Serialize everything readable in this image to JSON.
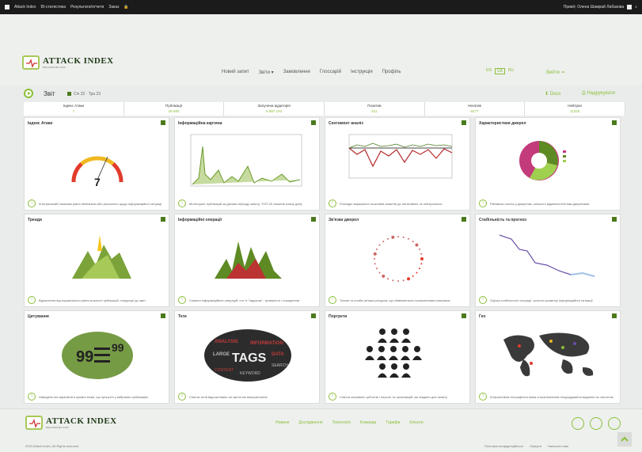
{
  "topbar": {
    "items": [
      "Attack Index",
      "BI-статистика",
      "Результати/отчети",
      "Заказ"
    ],
    "greeting": "Привіт, Олена Шамрай Лабазова"
  },
  "brand": {
    "name": "ATTACK INDEX",
    "tagline": "ВІД ІНТЕРНЕТ-АТАК"
  },
  "nav": [
    "Новий запит",
    "Звіти ▾",
    "Замовлення",
    "Глоссарій",
    "Інструкція",
    "Профіль"
  ],
  "lang": [
    "EN",
    "UA",
    "RU"
  ],
  "login": "Вийти ⇒",
  "toolbar": {
    "title": "Звіт",
    "dates": "Січ 22 · Тра 23",
    "export": "⬇ Docx",
    "print": "⎙ Надрукувати"
  },
  "stats": [
    {
      "label": "Індекс Атаки",
      "value": "7"
    },
    {
      "label": "Публікації",
      "value": "29 566"
    },
    {
      "label": "Залучена аудиторія",
      "value": "5 987 192"
    },
    {
      "label": "Позитив",
      "value": "911"
    },
    {
      "label": "Негатив",
      "value": "8477"
    },
    {
      "label": "Нейтрал",
      "value": "11326"
    }
  ],
  "panels": [
    {
      "title": "Індекс Атаки",
      "desc": "Інтегральний показник рівня небезпеки або реального щодо інформаційної ситуації"
    },
    {
      "title": "Інформаційна картина",
      "desc": "Моніторинг публікацій за датами періоду запиту, ТОП-20 сюжетів кожну добу"
    },
    {
      "title": "Сентимент аналіз",
      "desc": "Розподіл виражених позитивів сюжетів до негативних та нейтральних"
    },
    {
      "title": "Характеристики джерел",
      "desc": "Рівняюча частка у джерелах, кількість відмінностей між джерелами"
    },
    {
      "title": "Тренди",
      "desc": "Відхилення від нормального рівня кількості публікацій, тенденції до змін"
    },
    {
      "title": "Інформаційні операції",
      "desc": "Сюжети інформаційних операцій, хто їх \"підкачає\", тривалість і поширення"
    },
    {
      "title": "Зв'язки джерел",
      "desc": "Типові та слабкі зв'язки ресурсів, що обмінюються позначеннями ключових"
    },
    {
      "title": "Стабільність та прогноз",
      "desc": "Оцінка стабільності ситуації, прогноз розвитку інформаційної ситуації"
    },
    {
      "title": "Цитування",
      "desc": "Наведено всі фрагменти прямої мови, що присутні у вибраних публікаціях"
    },
    {
      "title": "Теги",
      "desc": "Список тегів відсортовано за частотою використання"
    },
    {
      "title": "Портрети",
      "desc": "Список значимих суб'єктів / персон та організацій, які згадано для запиту"
    },
    {
      "title": "Гео",
      "desc": "Інтерактивна географічна мапа із визначенням геоурядування видання за частотою"
    }
  ],
  "gauge_value": "7",
  "tags_center": "TAGS",
  "tag_words": [
    "ANALYSIS",
    "INFORMATION",
    "LARGE",
    "DATA",
    "SEARCH",
    "CONTENT",
    "KEYWORD"
  ],
  "footer": {
    "nav": [
      "Новини",
      "Дослідження",
      "Технології",
      "Команда",
      "Тарифи",
      "Клієнти"
    ],
    "copyright": "2023 Attack Index, All Rights reserved",
    "links": [
      "Політика конфіденційності",
      "Оферта",
      "Напишіть нам"
    ]
  },
  "colors": {
    "accent": "#8bbf3a",
    "dark": "#4a7a1c"
  }
}
